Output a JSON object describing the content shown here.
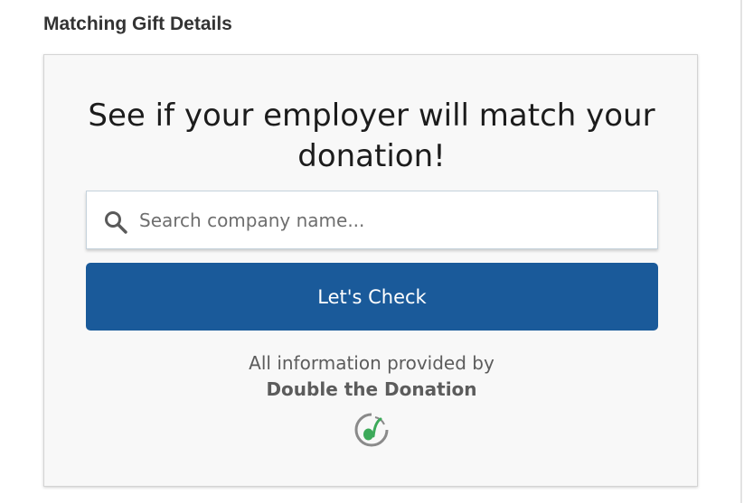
{
  "section": {
    "heading": "Matching Gift Details"
  },
  "widget": {
    "headline": "See if your employer will match your donation!",
    "search": {
      "placeholder": "Search company name...",
      "value": ""
    },
    "check_button_label": "Let's Check",
    "attribution_prefix": "All information provided by",
    "attribution_brand": "Double the Donation"
  },
  "colors": {
    "button_bg": "#1a5a9a",
    "card_bg": "#f8f8f8",
    "logo_green": "#3daa5a",
    "logo_gray": "#8a8a8a"
  },
  "icons": {
    "search": "search-icon",
    "brand": "double-the-donation-logo-icon"
  }
}
